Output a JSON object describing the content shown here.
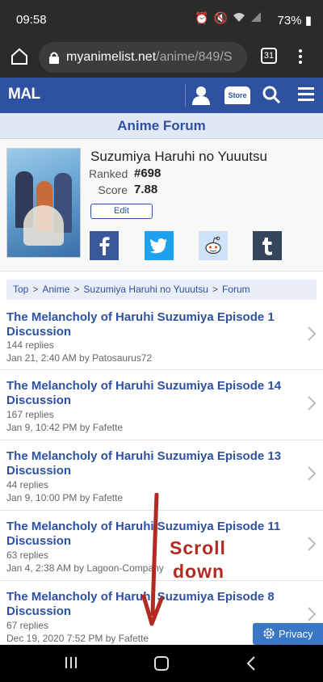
{
  "status": {
    "time": "09:58",
    "battery": "73%"
  },
  "browser": {
    "url_host": "myanimelist.net",
    "url_path": "/anime/849/S",
    "tab_count": "31"
  },
  "header": {
    "logo": "MAL",
    "store_label": "Store",
    "brand_color": "#2e51a2"
  },
  "forum_title": "Anime Forum",
  "anime": {
    "title": "Suzumiya Haruhi no Yuuutsu",
    "ranked_label": "Ranked",
    "ranked_value": "#698",
    "score_label": "Score",
    "score_value": "7.88",
    "edit_label": "Edit"
  },
  "breadcrumb": [
    "Top",
    "Anime",
    "Suzumiya Haruhi no Yuuutsu",
    "Forum"
  ],
  "topics": [
    {
      "title": "The Melancholy of Haruhi Suzumiya Episode 1 Discussion",
      "replies": "144 replies",
      "meta": "Jan 21, 2:40 AM by Patosaurus72"
    },
    {
      "title": "The Melancholy of Haruhi Suzumiya Episode 14 Discussion",
      "replies": "167 replies",
      "meta": "Jan 9, 10:42 PM by Fafette"
    },
    {
      "title": "The Melancholy of Haruhi Suzumiya Episode 13 Discussion",
      "replies": "44 replies",
      "meta": "Jan 9, 10:00 PM by Fafette"
    },
    {
      "title": "The Melancholy of Haruhi Suzumiya Episode 11 Discussion",
      "replies": "63 replies",
      "meta": "Jan 4, 2:38 AM by Lagoon-Company"
    },
    {
      "title": "The Melancholy of Haruhi Suzumiya Episode 8 Discussion",
      "replies": "67 replies",
      "meta": "Dec 19, 2020 7:52 PM by Fafette"
    }
  ],
  "annotation": {
    "line1": "Scroll",
    "line2": "down",
    "color": "#b22a22"
  },
  "privacy_label": "Privacy"
}
